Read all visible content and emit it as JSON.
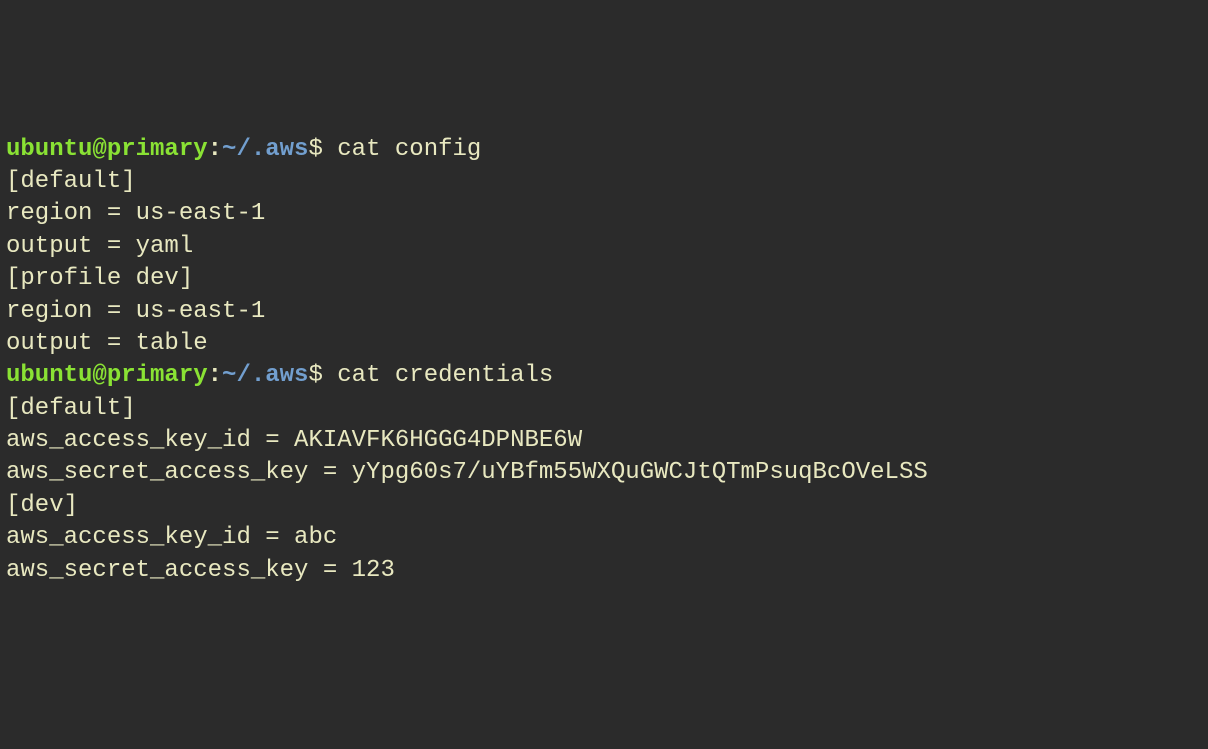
{
  "prompts": [
    {
      "user": "ubuntu@primary",
      "colon": ":",
      "path": "~/.aws",
      "dollar": "$ ",
      "command": "cat config"
    },
    {
      "user": "ubuntu@primary",
      "colon": ":",
      "path": "~/.aws",
      "dollar": "$ ",
      "command": "cat credentials"
    }
  ],
  "outputs": {
    "config": [
      "[default]",
      "region = us-east-1",
      "output = yaml",
      "[profile dev]",
      "region = us-east-1",
      "output = table"
    ],
    "credentials": [
      "[default]",
      "aws_access_key_id = AKIAVFK6HGGG4DPNBE6W",
      "aws_secret_access_key = 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",
      "[dev]",
      "aws_access_key_id = abc",
      "aws_secret_access_key = 123"
    ]
  }
}
